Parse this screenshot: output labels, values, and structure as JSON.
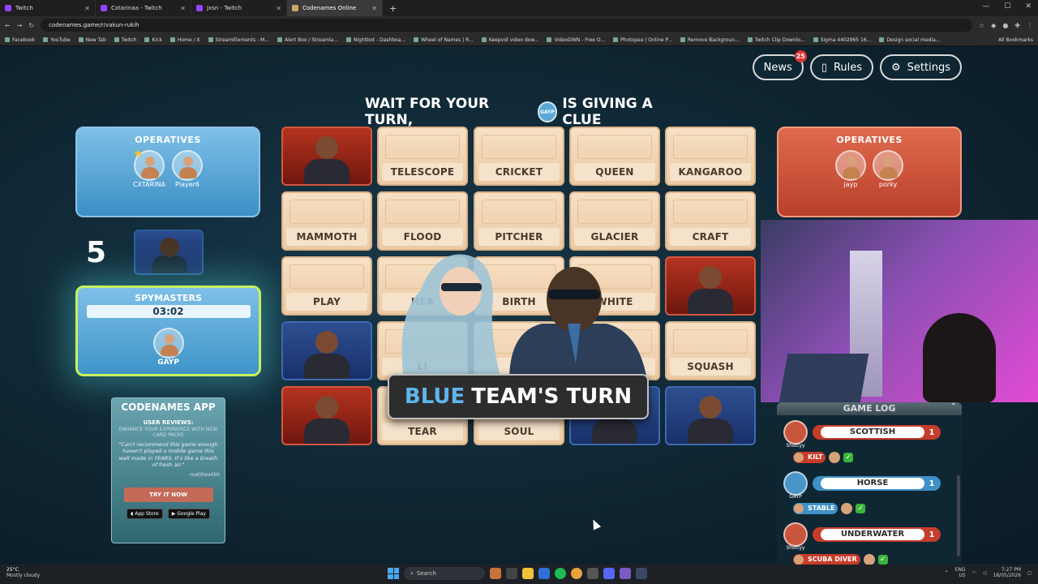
{
  "browser": {
    "tabs": [
      {
        "title": "Twitch",
        "active": false
      },
      {
        "title": "Cxtarinaa - Twitch",
        "active": false
      },
      {
        "title": "Jxsn - Twitch",
        "active": false
      },
      {
        "title": "Codenames Online",
        "active": true
      }
    ],
    "url": "codenames.game/r/vakun-rukih",
    "bookmarks": [
      "Facebook",
      "YouTube",
      "New Tab",
      "Twitch",
      "Kick",
      "Home / X",
      "StreamElements - M...",
      "Alert Box / Streamla...",
      "Nightbot - Dashboa...",
      "Wheel of Names | R...",
      "Keepvid video dow...",
      "VideoDWN - Free O...",
      "Photopea | Online P...",
      "Remove Backgroun...",
      "Twitch Clip Downlo...",
      "Sigma 4402965 16...",
      "Design social media..."
    ],
    "all_bookmarks": "All Bookmarks"
  },
  "topbar": {
    "news_label": "News",
    "news_badge": "25",
    "rules_label": "Rules",
    "settings_label": "Settings"
  },
  "clue_banner": {
    "prefix": "WAIT FOR YOUR TURN,",
    "avatar_name": "GAYP",
    "suffix": "IS GIVING A CLUE"
  },
  "blue_team": {
    "operatives_title": "OPERATIVES",
    "operatives": [
      "CXTARINA",
      "Player6"
    ],
    "score": "5",
    "spymasters_title": "SPYMASTERS",
    "timer": "03:02",
    "spymaster": "GAYP"
  },
  "red_team": {
    "operatives_title": "OPERATIVES",
    "operatives": [
      "jayp",
      "porky"
    ]
  },
  "app_ad": {
    "title": "CODENAMES APP",
    "reviews_label": "USER REVIEWS:",
    "subtitle": "ENHANCE YOUR EXPERIENCE WITH NEW CARD PACKS",
    "quote": "\"Can't recommend this game enough haven't played a mobile game this well made in YEARS. It's like a breath of fresh air.\"",
    "author": "-matthewtbh",
    "cta": "TRY IT NOW",
    "store1": "App Store",
    "store2": "Google Play"
  },
  "board": {
    "cards": [
      {
        "type": "red",
        "label": ""
      },
      {
        "type": "word",
        "label": "TELESCOPE"
      },
      {
        "type": "word",
        "label": "CRICKET"
      },
      {
        "type": "word",
        "label": "QUEEN"
      },
      {
        "type": "word",
        "label": "KANGAROO"
      },
      {
        "type": "word",
        "label": "MAMMOTH"
      },
      {
        "type": "word",
        "label": "FLOOD"
      },
      {
        "type": "word",
        "label": "PITCHER"
      },
      {
        "type": "word",
        "label": "GLACIER"
      },
      {
        "type": "word",
        "label": "CRAFT"
      },
      {
        "type": "word",
        "label": "PLAY"
      },
      {
        "type": "word",
        "label": "HEA"
      },
      {
        "type": "word",
        "label": "BIRTH"
      },
      {
        "type": "word",
        "label": "WHITE"
      },
      {
        "type": "red",
        "label": ""
      },
      {
        "type": "blue",
        "label": ""
      },
      {
        "type": "word",
        "label": "LI"
      },
      {
        "type": "word",
        "label": "P"
      },
      {
        "type": "word",
        "label": ""
      },
      {
        "type": "word",
        "label": "SQUASH"
      },
      {
        "type": "red",
        "label": ""
      },
      {
        "type": "word",
        "label": "TEAR"
      },
      {
        "type": "word",
        "label": "SOUL"
      },
      {
        "type": "blue",
        "label": ""
      },
      {
        "type": "blue",
        "label": ""
      }
    ],
    "turn_team": "BLUE",
    "turn_text": "TEAM'S TURN"
  },
  "game_log": {
    "title": "GAME LOG",
    "entries": [
      {
        "team": "red",
        "giver": "Shottyy",
        "clue": "SCOTTISH",
        "number": "1",
        "guess": "KILT",
        "guess_team": "red",
        "by": "porky"
      },
      {
        "team": "blue",
        "giver": "GAYP",
        "clue": "HORSE",
        "number": "1",
        "guess": "STABLE",
        "guess_team": "blue",
        "by": "CXTARINA"
      },
      {
        "team": "red",
        "giver": "Shottyy",
        "clue": "UNDERWATER",
        "number": "1",
        "guess": "SCUBA DIVER",
        "guess_team": "red",
        "by": "porky"
      }
    ]
  },
  "taskbar": {
    "temp": "25°C",
    "weather": "Mostly cloudy",
    "search": "Search",
    "lang1": "ENG",
    "lang2": "US",
    "time": "7:27 PM",
    "date": "18/05/2026"
  },
  "colors": {
    "blue_team": "#5fb5ea",
    "red_team": "#c73d2b",
    "card_beige": "#f5e2ca",
    "highlight": "#c8f060"
  }
}
